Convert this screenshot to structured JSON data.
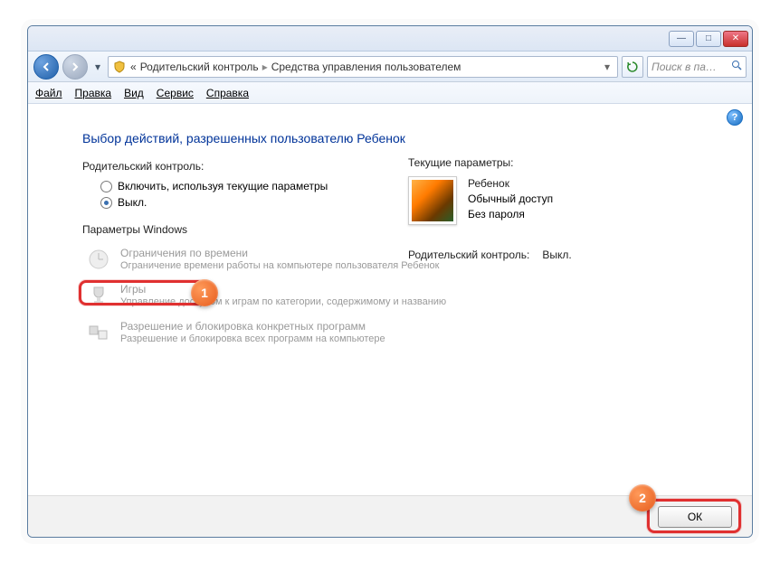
{
  "window": {
    "minimize": "—",
    "maximize": "□",
    "close": "✕"
  },
  "nav": {
    "back": "◄",
    "forward": "►",
    "dropdown": "▾"
  },
  "breadcrumb": {
    "prefix": "«",
    "level1": "Родительский контроль",
    "sep": "▸",
    "level2": "Средства управления пользователем",
    "drop": "▾"
  },
  "refresh": "↻",
  "search": {
    "placeholder": "Поиск в па…",
    "icon": "🔍"
  },
  "menu": {
    "file": "Файл",
    "edit": "Правка",
    "view": "Вид",
    "service": "Сервис",
    "help": "Справка"
  },
  "help_icon": "?",
  "heading": "Выбор действий, разрешенных пользователю Ребенок",
  "pc_label": "Родительский контроль:",
  "radios": {
    "on": "Включить, используя текущие параметры",
    "off": "Выкл."
  },
  "win_params": "Параметры Windows",
  "items": {
    "time": {
      "title": "Ограничения по времени",
      "desc": "Ограничение времени работы на компьютере пользователя Ребенок"
    },
    "games": {
      "title": "Игры",
      "desc": "Управление доступом к играм по категории, содержимому и названию"
    },
    "programs": {
      "title": "Разрешение и блокировка конкретных программ",
      "desc": "Разрешение и блокировка всех программ на компьютере"
    }
  },
  "right": {
    "cur_params": "Текущие параметры:",
    "username": "Ребенок",
    "access": "Обычный доступ",
    "password": "Без пароля",
    "pc_row_label": "Родительский контроль:",
    "pc_row_value": "Выкл."
  },
  "footer": {
    "ok": "ОК"
  },
  "callouts": {
    "one": "1",
    "two": "2"
  }
}
